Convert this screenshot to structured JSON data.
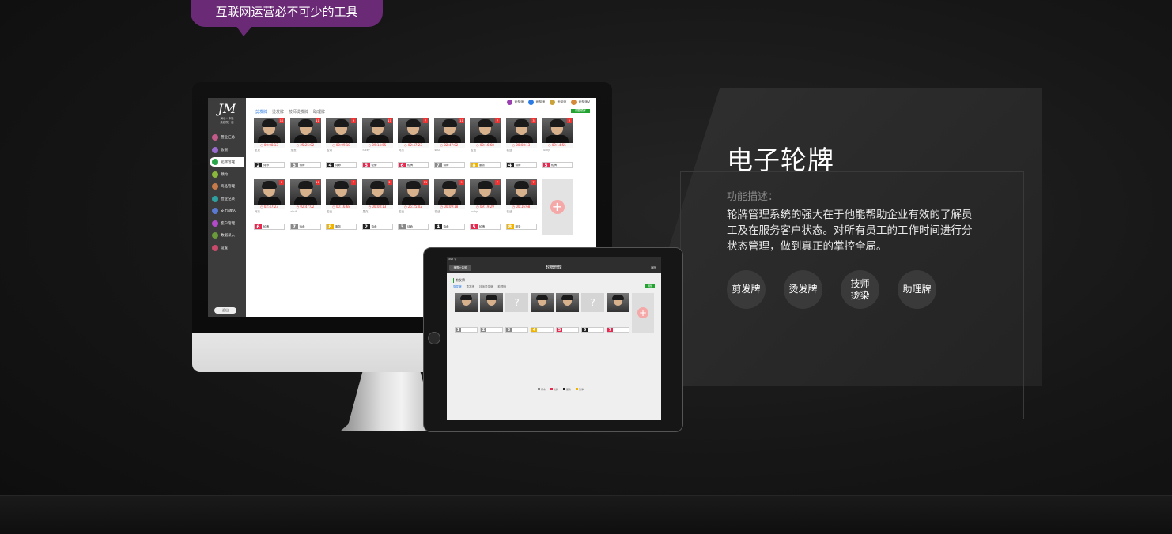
{
  "banner": {
    "bubble_text": "互联网运营必不可少的工具"
  },
  "feature": {
    "title": "电子轮牌",
    "desc_label": "功能描述：",
    "desc_text": "轮牌管理系统的强大在于他能帮助企业有效的了解员工及在服务客户状态。对所有员工的工作时间进行分状态管理，做到真正的掌控全局。",
    "tags": [
      {
        "label": "剪发牌"
      },
      {
        "label": "烫发牌"
      },
      {
        "label": "技师\n烫染"
      },
      {
        "label": "助理牌"
      }
    ]
  },
  "desktop_app": {
    "logo": "JM",
    "store_line1": "演示+体验",
    "store_line2": "美容院 · 店",
    "nav": [
      {
        "label": "营业汇总",
        "color": "#c45a8a"
      },
      {
        "label": "收银",
        "color": "#9a6bd1"
      },
      {
        "label": "轮牌管理",
        "color": "#2aa54a",
        "active": true
      },
      {
        "label": "预约",
        "color": "#8ab83a"
      },
      {
        "label": "商品管理",
        "color": "#c97a4a"
      },
      {
        "label": "营业记录",
        "color": "#2fa0a0"
      },
      {
        "label": "支出/收入",
        "color": "#5a7ad1"
      },
      {
        "label": "客户管理",
        "color": "#b24ac9"
      },
      {
        "label": "数据录入",
        "color": "#6a9a3a"
      },
      {
        "label": "设置",
        "color": "#c94a6a"
      }
    ],
    "logout": "退出",
    "tabs": [
      "剪发牌",
      "烫发牌",
      "技师烫发牌",
      "助理牌"
    ],
    "users": [
      "发型师",
      "发型师",
      "发型师",
      "发型师V"
    ],
    "green_button": "调整顺序",
    "row1": [
      {
        "num": "10",
        "time": "00:08:13",
        "name": "里克",
        "pos": 2,
        "color": "#222",
        "state": "待命"
      },
      {
        "num": "11",
        "time": "25:25:02",
        "name": "龙龙",
        "pos": 3,
        "color": "#888",
        "state": "待命"
      },
      {
        "num": "9",
        "time": "00:09:18",
        "name": "若湖",
        "pos": 4,
        "color": "#222",
        "state": "待命"
      },
      {
        "num": "17",
        "time": "09:14:55",
        "name": "lucky",
        "pos": 5,
        "color": "#e8284f",
        "state": "轮牌"
      },
      {
        "num": "7",
        "time": "02:47:23",
        "name": "阿杰",
        "pos": 6,
        "color": "#e8284f",
        "state": "轮牌"
      },
      {
        "num": "11",
        "time": "02:47:02",
        "name": "skull",
        "pos": 7,
        "color": "#888",
        "state": "待命"
      },
      {
        "num": "7",
        "time": "00:16:68",
        "name": "若迪",
        "pos": 8,
        "color": "#f0b400",
        "state": "服务"
      },
      {
        "num": "3",
        "time": "00:08:13",
        "name": "若迪",
        "pos": 4,
        "color": "#222",
        "state": "待命"
      },
      {
        "num": "2",
        "time": "09:14:55",
        "name": "lucky",
        "pos": 5,
        "color": "#e8284f",
        "state": "轮牌"
      }
    ],
    "row2": [
      {
        "num": "8",
        "time": "02:47:23",
        "name": "阿杰",
        "pos": 6,
        "color": "#e8284f",
        "state": "轮牌"
      },
      {
        "num": "11",
        "time": "02:47:02",
        "name": "skull",
        "pos": 7,
        "color": "#888",
        "state": "待命"
      },
      {
        "num": "7",
        "time": "00:16:68",
        "name": "若迪",
        "pos": 8,
        "color": "#f0b400",
        "state": "服务"
      },
      {
        "num": "2",
        "time": "00:08:13",
        "name": "里克",
        "pos": 2,
        "color": "#222",
        "state": "待命"
      },
      {
        "num": "11",
        "time": "25:25:02",
        "name": "若迪",
        "pos": 3,
        "color": "#888",
        "state": "待命"
      },
      {
        "num": "9",
        "time": "00:09:18",
        "name": "若迪",
        "pos": 4,
        "color": "#222",
        "state": "待命"
      },
      {
        "num": "7",
        "time": "09:19:29",
        "name": "lucky",
        "pos": 5,
        "color": "#e8284f",
        "state": "轮牌"
      },
      {
        "num": "7",
        "time": "00:16:68",
        "name": "若迪",
        "pos": 8,
        "color": "#f0b400",
        "state": "服务"
      }
    ]
  },
  "tablet_app": {
    "status": "iPad 令",
    "back": "美霓+体验",
    "title": "轮牌管理",
    "return": "返回",
    "section": "剪发牌",
    "tabs": [
      "剪发牌",
      "烫发牌",
      "技师烫发牌",
      "助理牌"
    ],
    "green_button": "调整",
    "cards": [
      {
        "pos": 1,
        "color": "#888",
        "face": true
      },
      {
        "pos": 2,
        "color": "#888",
        "face": true
      },
      {
        "pos": 3,
        "color": "#888",
        "face": false
      },
      {
        "pos": 4,
        "color": "#f0b400",
        "face": true
      },
      {
        "pos": 5,
        "color": "#e8284f",
        "face": true
      },
      {
        "pos": 6,
        "color": "#222",
        "face": false
      },
      {
        "pos": 7,
        "color": "#e8284f",
        "face": true
      }
    ],
    "legend": [
      {
        "label": "待命",
        "color": "#888"
      },
      {
        "label": "轮牌",
        "color": "#e8284f"
      },
      {
        "label": "服务",
        "color": "#222"
      },
      {
        "label": "暂停",
        "color": "#f0b400"
      }
    ]
  }
}
